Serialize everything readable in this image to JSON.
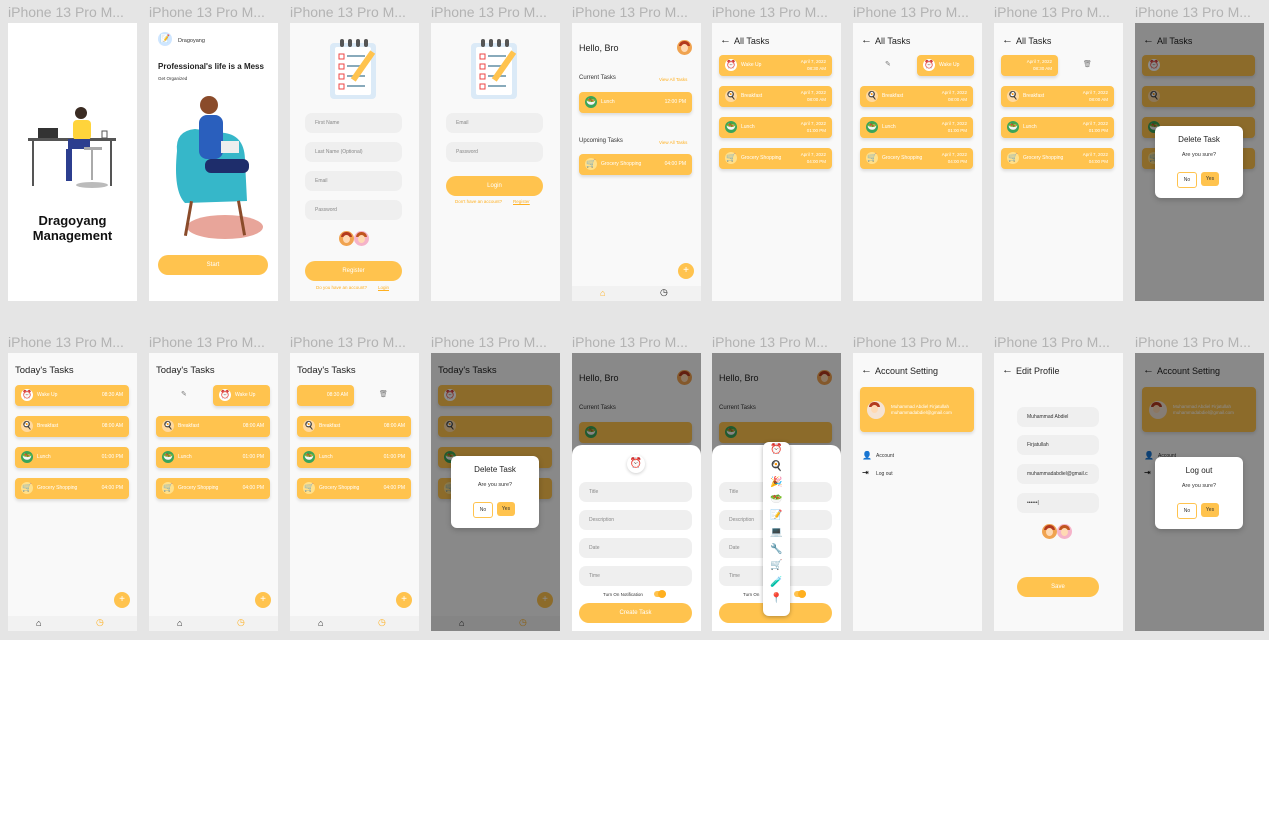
{
  "frame_label": "iPhone 13 Pro M...",
  "splash": {
    "title_line1": "Dragoyang",
    "title_line2": "Management"
  },
  "onboard": {
    "app_name": "Dragoyang",
    "headline": "Professional's life is a Mess",
    "subline": "Get Organized",
    "start_label": "Start"
  },
  "register": {
    "first_name": "First Name",
    "last_name": "Last Name (Optional)",
    "email": "Email",
    "password": "Password",
    "button": "Register",
    "prompt": "Do you have an account?",
    "login_link": "Login"
  },
  "login": {
    "email": "Email",
    "password": "Password",
    "button": "Login",
    "prompt": "Don't have an account?",
    "register_link": "Register"
  },
  "home": {
    "greeting": "Hello, Bro",
    "current_tasks": "Current Tasks",
    "upcoming_tasks": "Upcoming Tasks",
    "view_all": "View All Tasks",
    "current": {
      "name": "Lunch",
      "time": "12:00 PM"
    },
    "upcoming": {
      "name": "Grocery Shopping",
      "time": "04:00 PM"
    }
  },
  "all_tasks": {
    "title": "All Tasks",
    "tasks": [
      {
        "name": "Wake Up",
        "date": "April 7, 2022",
        "time": "08:30 AM"
      },
      {
        "name": "Breakfast",
        "date": "April 7, 2022",
        "time": "08:00 AM"
      },
      {
        "name": "Lunch",
        "date": "April 7, 2022",
        "time": "01:00 PM"
      },
      {
        "name": "Grocery Shopping",
        "date": "April 7, 2022",
        "time": "04:00 PM"
      }
    ]
  },
  "today": {
    "title": "Today's Tasks",
    "tasks": [
      {
        "name": "Wake Up",
        "time": "08:30 AM"
      },
      {
        "name": "Breakfast",
        "time": "08:00 AM"
      },
      {
        "name": "Lunch",
        "time": "01:00 PM"
      },
      {
        "name": "Grocery Shopping",
        "time": "04:00 PM"
      }
    ]
  },
  "delete_dialog": {
    "title": "Delete Task",
    "question": "Are you sure?",
    "no": "No",
    "yes": "Yes"
  },
  "create_task": {
    "title": "Title",
    "description": "Description",
    "date": "Date",
    "time": "Time",
    "notification": "Turn On Notification",
    "button": "Create Task",
    "notification_short": "Turn On"
  },
  "account": {
    "title": "Account Setting",
    "name": "Muhammad Abdiel Firjatullah",
    "email": "muhammadabdiel@gmail.com",
    "menu_account": "Account",
    "menu_logout": "Log out"
  },
  "edit_profile": {
    "title": "Edit Profile",
    "first": "Muhammad Abdiel",
    "last": "Firjatullah",
    "email": "muhammadabdiel@gmail.c",
    "password": "••••••|",
    "save": "Save"
  },
  "logout_dialog": {
    "title": "Log out",
    "question": "Are you sure?",
    "no": "No",
    "yes": "Yes"
  },
  "colors": {
    "accent": "#ffc34e",
    "canvas": "#e5e5e5"
  },
  "icons": [
    "clock-icon",
    "breakfast-icon",
    "lunch-icon",
    "cart-icon",
    "home-icon",
    "history-icon",
    "back-arrow-icon",
    "pencil-icon",
    "trash-icon",
    "person-icon",
    "logout-icon",
    "plus-icon"
  ]
}
